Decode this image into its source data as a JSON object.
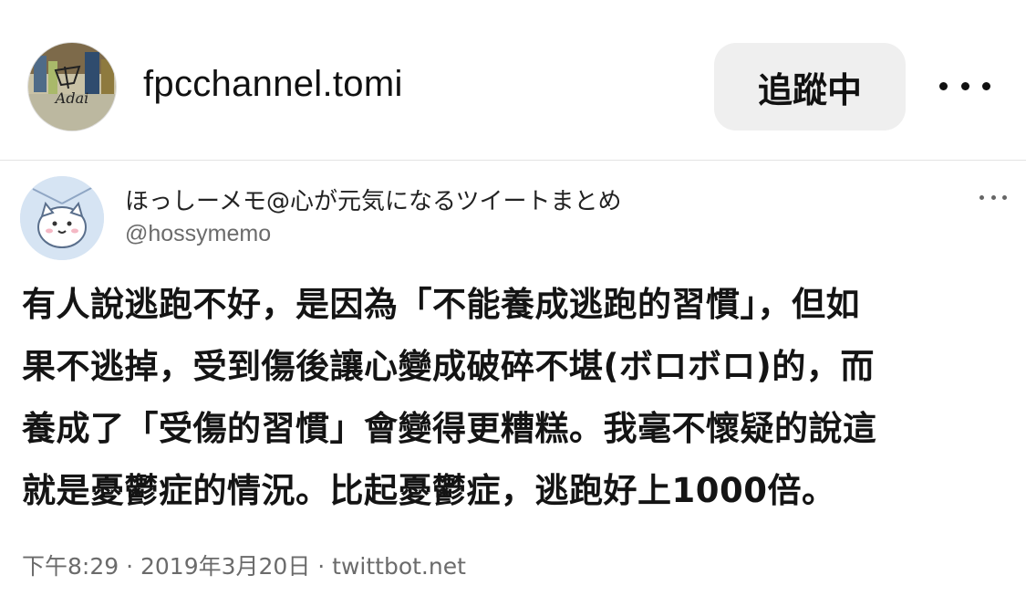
{
  "header": {
    "username": "fpcchannel.tomi",
    "follow_label": "追蹤中",
    "avatar_text": "Adai",
    "more_icon": "more-horizontal-icon"
  },
  "tweet": {
    "display_name": "ほっしーメモ@心が元気になるツイートまとめ",
    "handle": "@hossymemo",
    "lines": [
      "有人說逃跑不好，是因為「不能養成逃跑的習慣」，但如",
      "果不逃掉，受到傷後讓心變成破碎不堪(ボロボロ)的，而",
      "養成了「受傷的習慣」會變得更糟糕。我毫不懷疑的說這",
      "就是憂鬱症的情況。比起憂鬱症，逃跑好上1000倍。"
    ],
    "meta": "下午8:29 · 2019年3月20日 · twittbot.net",
    "more_icon": "more-horizontal-icon"
  },
  "colors": {
    "follow_bg": "#efefef",
    "secondary_text": "#6b6b6b",
    "divider": "#e4e4e4"
  }
}
